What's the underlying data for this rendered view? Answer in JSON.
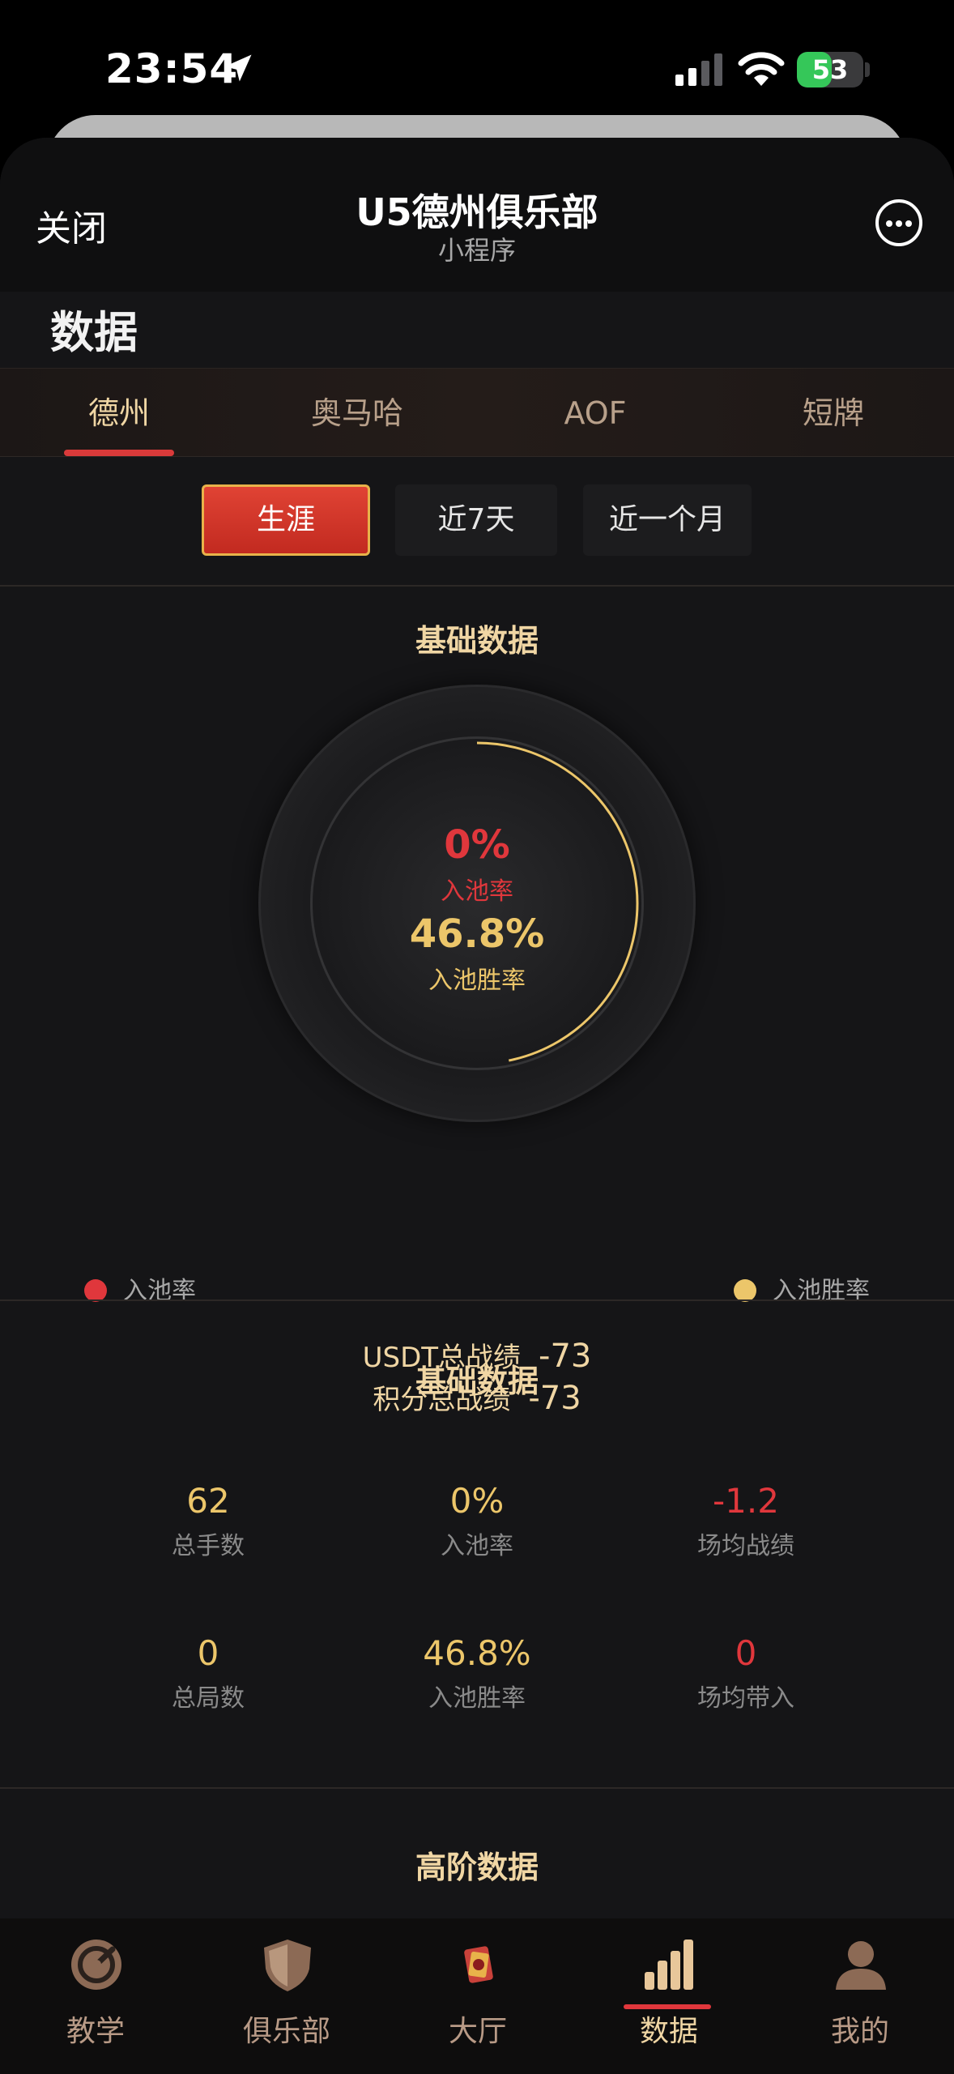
{
  "status_bar": {
    "time": "23:54",
    "battery": "53",
    "battery_level": 0.53
  },
  "nav": {
    "close_label": "关闭",
    "title": "U5德州俱乐部",
    "subtitle": "小程序"
  },
  "page": {
    "title": "数据"
  },
  "game_tabs": [
    {
      "label": "德州",
      "active": true
    },
    {
      "label": "奥马哈",
      "active": false
    },
    {
      "label": "AOF",
      "active": false
    },
    {
      "label": "短牌",
      "active": false
    }
  ],
  "periods": [
    {
      "label": "生涯",
      "active": true
    },
    {
      "label": "近7天",
      "active": false
    },
    {
      "label": "近一个月",
      "active": false
    }
  ],
  "basic_section": {
    "title": "基础数据",
    "ring": {
      "vpip_value": "0%",
      "vpip_label": "入池率",
      "win_value": "46.8%",
      "win_label": "入池胜率",
      "vpip_fraction": 0.0,
      "win_fraction": 0.468,
      "vpip_color": "#e0373c",
      "win_color": "#ecc66a"
    },
    "legend": {
      "left": "入池率",
      "right": "入池胜率"
    },
    "totals": {
      "usdt_label": "USDT总战绩",
      "usdt_value": "-73",
      "points_label": "积分总战绩",
      "points_value": "-73"
    }
  },
  "stats_section": {
    "title": "基础数据",
    "stats": [
      {
        "value": "62",
        "label": "总手数"
      },
      {
        "value": "0%",
        "label": "入池率"
      },
      {
        "value": "-1.2",
        "label": "场均战绩"
      },
      {
        "value": "0",
        "label": "总局数"
      },
      {
        "value": "46.8%",
        "label": "入池胜率"
      },
      {
        "value": "0",
        "label": "场均带入"
      }
    ]
  },
  "advanced_section": {
    "title": "高阶数据"
  },
  "tab_bar": [
    {
      "label": "教学",
      "icon": "gauge-icon"
    },
    {
      "label": "俱乐部",
      "icon": "shield-icon"
    },
    {
      "label": "大厅",
      "icon": "hall-icon"
    },
    {
      "label": "数据",
      "icon": "bar-chart-icon",
      "active": true
    },
    {
      "label": "我的",
      "icon": "user-icon"
    }
  ],
  "colors": {
    "accent_red": "#d93a3a",
    "gold": "#f0d6a4",
    "yellow": "#ecc66a"
  }
}
